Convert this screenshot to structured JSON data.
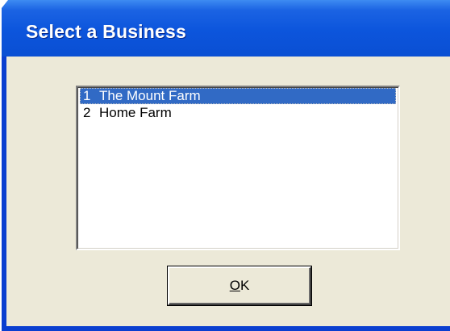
{
  "dialog": {
    "title": "Select a Business"
  },
  "business_list": {
    "items": [
      {
        "number": "1",
        "name": "The Mount Farm",
        "selected": true
      },
      {
        "number": "2",
        "name": "Home Farm",
        "selected": false
      }
    ]
  },
  "ok_button": {
    "label_mnemonic": "O",
    "label_rest": "K"
  },
  "colors": {
    "titlebar": "#0c55dc",
    "selection": "#316ac5",
    "dialog_face": "#ece9d8"
  }
}
